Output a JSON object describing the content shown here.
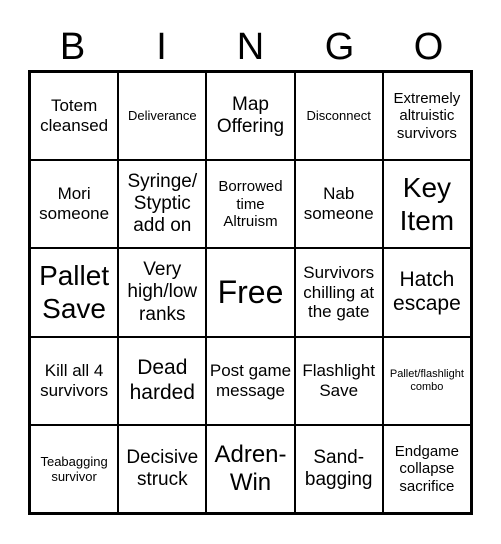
{
  "header": {
    "letters": [
      "B",
      "I",
      "N",
      "G",
      "O"
    ]
  },
  "cells": [
    [
      "Totem cleansed",
      "Deliverance",
      "Map Offering",
      "Disconnect",
      "Extremely altruistic survivors"
    ],
    [
      "Mori someone",
      "Syringe/ Styptic add on",
      "Borrowed time Altruism",
      "Nab someone",
      "Key Item"
    ],
    [
      "Pallet Save",
      "Very high/low ranks",
      "Free",
      "Survivors chilling at the gate",
      "Hatch escape"
    ],
    [
      "Kill all 4 survivors",
      "Dead harded",
      "Post game message",
      "Flashlight Save",
      "Pallet/flashlight combo"
    ],
    [
      "Teabagging survivor",
      "Decisive struck",
      "Adren-Win",
      "Sand-bagging",
      "Endgame collapse sacrifice"
    ]
  ]
}
